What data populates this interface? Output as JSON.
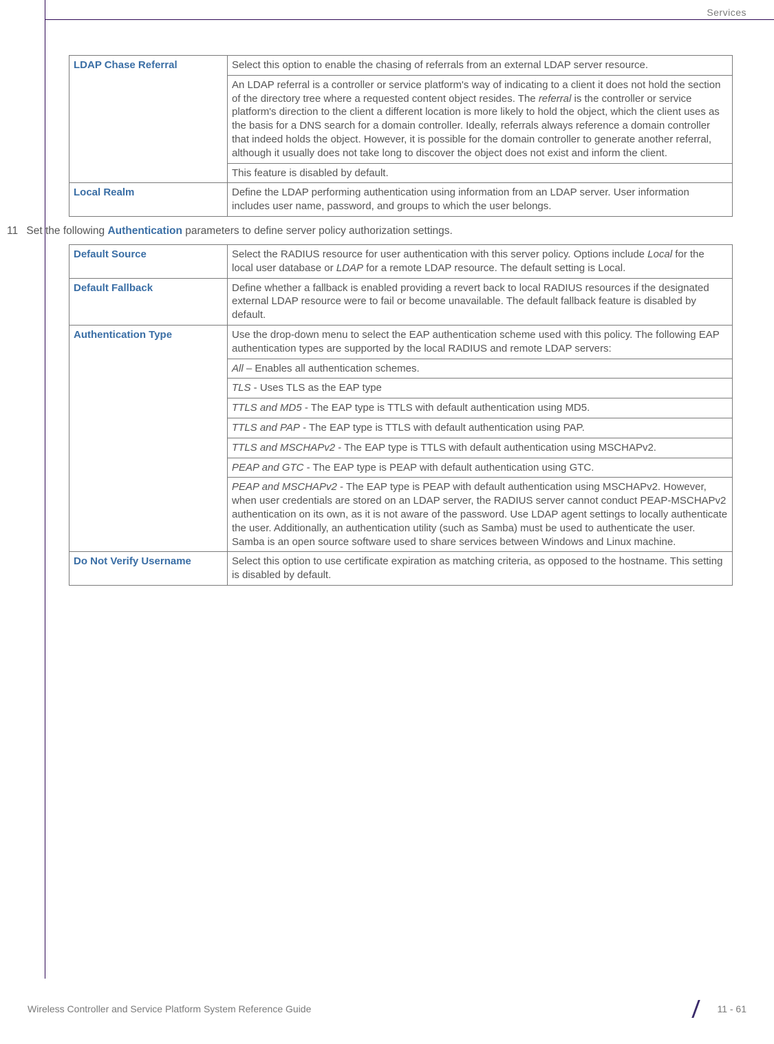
{
  "header": {
    "section": "Services"
  },
  "table1": {
    "rows": [
      {
        "label": "LDAP Chase Referral",
        "paras": [
          "Select this option to enable the chasing of referrals from an external LDAP server resource.",
          "An LDAP referral is a controller or service platform's way of indicating to a client it does not hold the section of the directory tree where a requested content object resides. The <i>referral</i> is the controller or service platform's direction to the client a different location is more likely to hold the object, which the client uses as the basis for a DNS search for a domain controller. Ideally, referrals always reference a domain controller that indeed holds the object. However, it is possible for the domain controller to generate another referral, although it usually does not take long to discover the object does not exist and inform the client.",
          "This feature is disabled by default."
        ]
      },
      {
        "label": "Local Realm",
        "paras": [
          "Define the LDAP performing authentication using information from an LDAP server. User information includes user name, password, and groups to which the user belongs."
        ]
      }
    ]
  },
  "step": {
    "num": "11",
    "before": "Set the following ",
    "auth": "Authentication",
    "after": " parameters to define server policy authorization settings."
  },
  "table2": {
    "rows": [
      {
        "label": "Default Source",
        "paras": [
          "Select the RADIUS resource for user authentication with this server policy. Options include <i>Local</i> for the local user database or <i>LDAP</i> for a remote LDAP resource. The default setting is Local."
        ]
      },
      {
        "label": "Default Fallback",
        "paras": [
          "Define whether a fallback is enabled providing a revert back to local RADIUS resources if the designated external LDAP resource were to fail or become unavailable. The default fallback feature is disabled by default."
        ]
      },
      {
        "label": "Authentication Type",
        "paras": [
          "Use the drop-down menu to select the EAP authentication scheme used with this policy. The following EAP authentication types are supported by the local RADIUS and remote LDAP servers:",
          "<i>All</i> – Enables all authentication schemes.",
          "<i>TLS</i> - Uses TLS as the EAP type",
          "<i>TTLS and MD5</i> - The EAP type is TTLS with default authentication using MD5.",
          "<i>TTLS and PAP</i> - The EAP type is TTLS with default authentication using PAP.",
          "<i>TTLS and MSCHAPv2</i> - The EAP type is TTLS with default authentication using MSCHAPv2.",
          "<i>PEAP and GTC</i> - The EAP type is PEAP with default authentication using GTC.",
          "<i>PEAP and MSCHAPv2</i> - The EAP type is PEAP with default authentication using MSCHAPv2. However, when user credentials are stored on an LDAP server, the RADIUS server cannot conduct PEAP-MSCHAPv2 authentication on its own, as it is not aware of the password. Use LDAP agent settings to locally authenticate the user. Additionally, an authentication utility (such as Samba) must be used to authenticate the user. Samba is an open source software used to share services between Windows and Linux machine."
        ]
      },
      {
        "label": "Do Not Verify Username",
        "paras": [
          "Select this option to use certificate expiration as matching criteria, as opposed to the hostname. This setting is disabled by default."
        ]
      }
    ]
  },
  "footer": {
    "left": "Wireless Controller and Service Platform System Reference Guide",
    "right": "11 - 61"
  }
}
